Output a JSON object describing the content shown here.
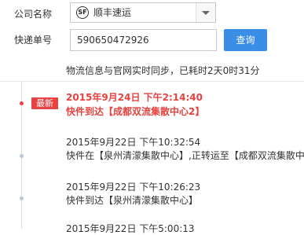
{
  "form": {
    "company_label": "公司名称",
    "company_logo_text": "SF",
    "company_value": "顺丰速运",
    "tracking_label": "快递单号",
    "tracking_value": "590650472926",
    "query_button_label": "查询"
  },
  "sync_notice": "物流信息与官网实时同步，已耗时2天0时31分",
  "latest_badge": "最新",
  "colors": {
    "accent_blue": "#3a8ee6",
    "latest_red": "#e64340",
    "timeline_dot": "#b8c6d8"
  },
  "timeline": [
    {
      "time": "2015年9月24日 下午2:14:40",
      "description": "快件到达【成都双流集散中心2】"
    },
    {
      "time": "2015年9月22日 下午10:32:54",
      "description": "快件在【泉州清濛集散中心】,正转运至【成都双流集散中"
    },
    {
      "time": "2015年9月22日 下午10:26:23",
      "description": "快件到达【泉州清濛集散中心】"
    },
    {
      "time": "2015年9月22日 下午5:00:13"
    }
  ]
}
